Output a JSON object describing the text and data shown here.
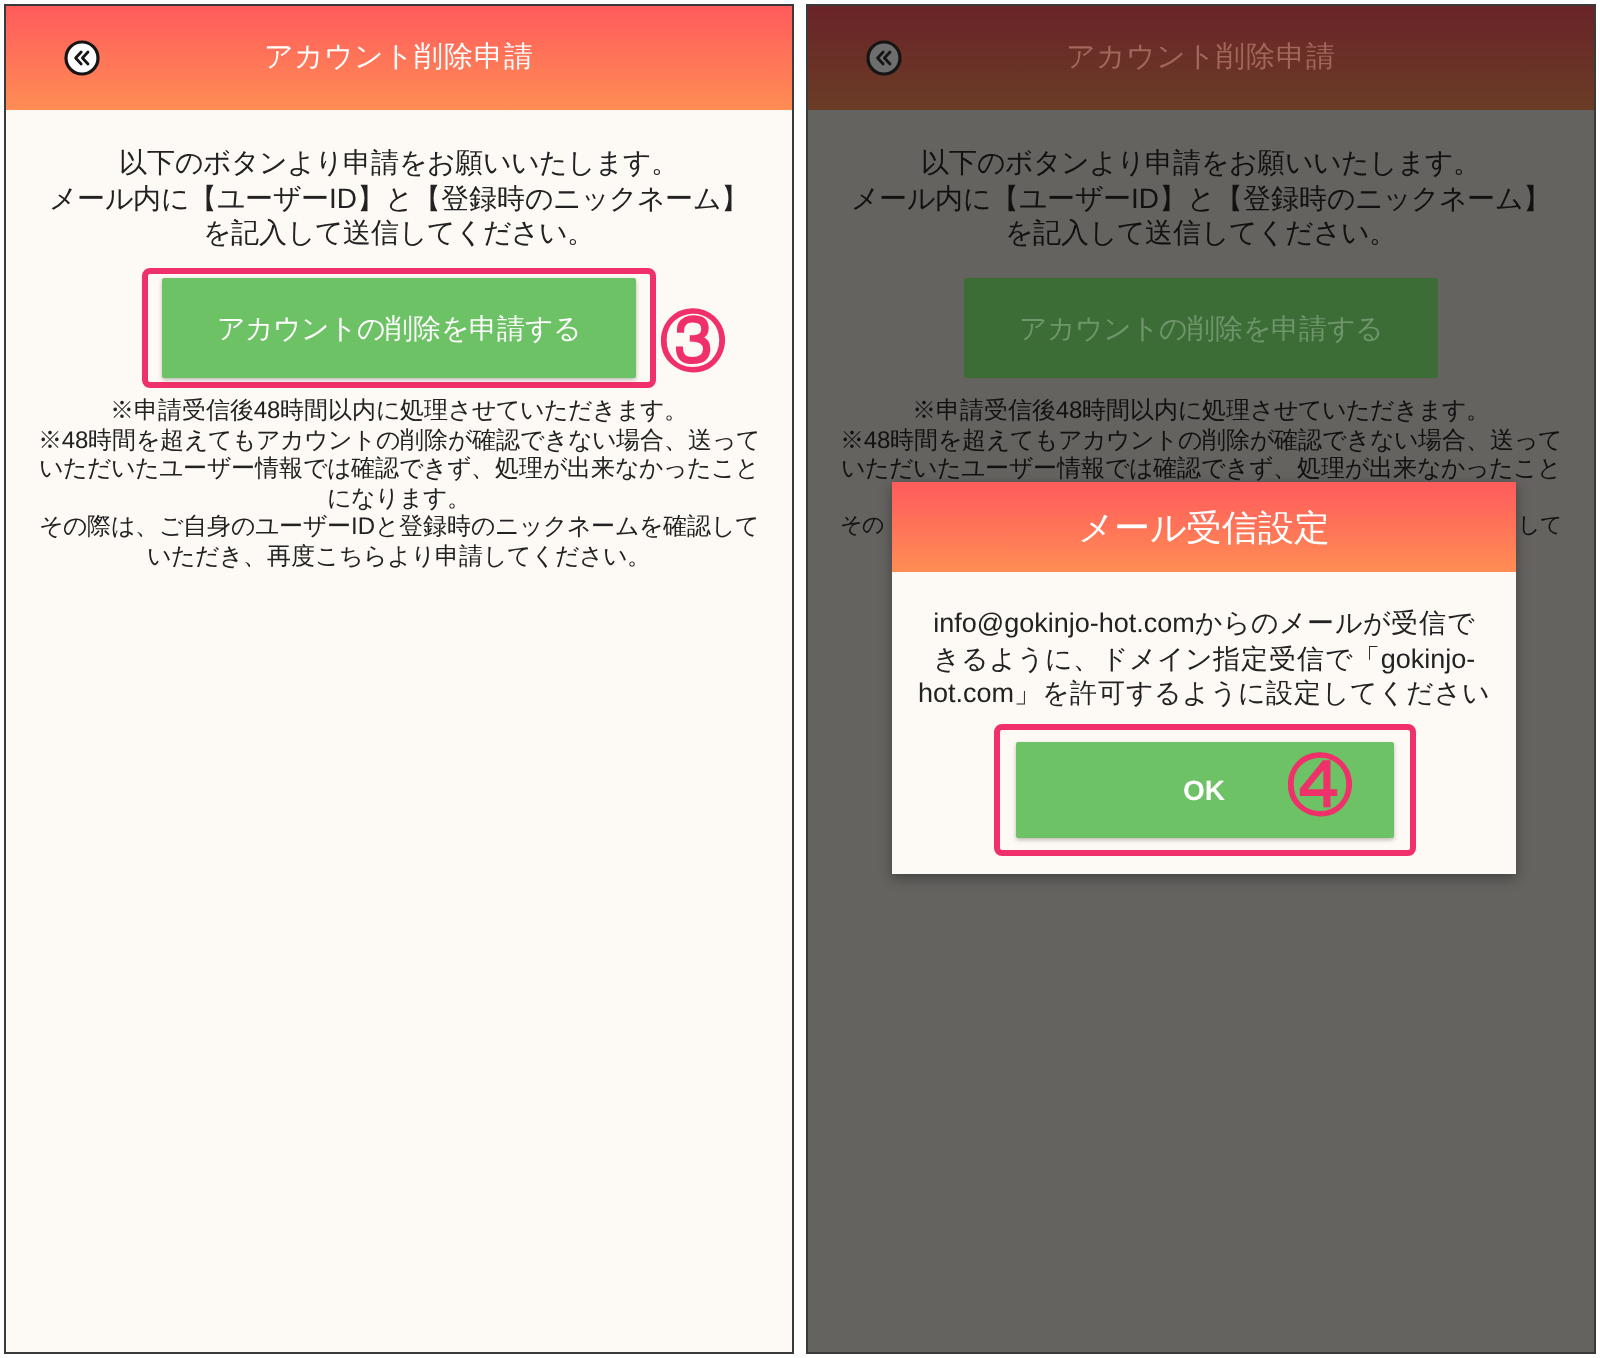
{
  "screens": [
    {
      "dimmed": false,
      "header": {
        "title": "アカウント削除申請"
      },
      "intro": [
        "以下のボタンより申請をお願いいたします。",
        "メール内に【ユーザーID】と【登録時のニックネーム】",
        "を記入して送信してください。"
      ],
      "button": {
        "label": "アカウントの削除を申請する",
        "highlighted": true,
        "step": "③"
      },
      "notes": [
        "※申請受信後48時間以内に処理させていただきます。",
        "※48時間を超えてもアカウントの削除が確認できない場合、送って",
        "いただいたユーザー情報では確認できず、処理が出来なかったこと",
        "になります。",
        "その際は、ご自身のユーザーIDと登録時のニックネームを確認して",
        "いただき、再度こちらより申請してください。"
      ]
    },
    {
      "dimmed": true,
      "header": {
        "title": "アカウント削除申請"
      },
      "intro": [
        "以下のボタンより申請をお願いいたします。",
        "メール内に【ユーザーID】と【登録時のニックネーム】",
        "を記入して送信してください。"
      ],
      "button": {
        "label": "アカウントの削除を申請する",
        "highlighted": false
      },
      "notes": [
        "※申請受信後48時間以内に処理させていただきます。",
        "※48時間を超えてもアカウントの削除が確認できない場合、送って",
        "いただいたユーザー情報では確認できず、処理が出来なかったこと"
      ],
      "note_fragments": [
        "その",
        "して"
      ],
      "dialog": {
        "title": "メール受信設定",
        "message": [
          "info@gokinjo-hot.comからのメールが受信で",
          "きるように、ドメイン指定受信で「gokinjo-",
          "hot.com」を許可するように設定してください"
        ],
        "button": {
          "label": "OK",
          "highlighted": true,
          "step": "④"
        }
      }
    }
  ]
}
